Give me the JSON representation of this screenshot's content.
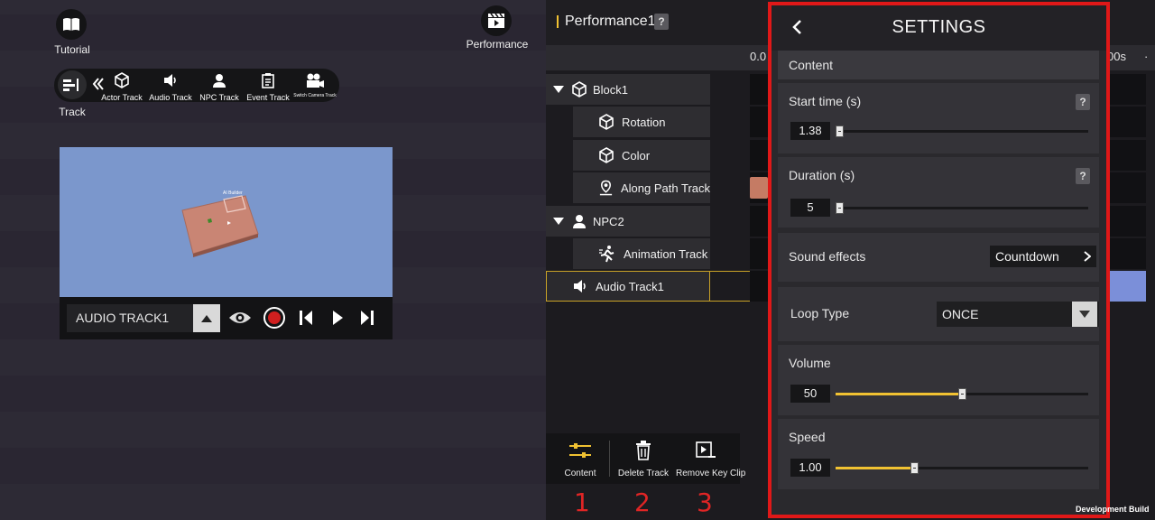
{
  "top_left": {
    "tutorial_label": "Tutorial",
    "track_label": "Track",
    "performance_label": "Performance"
  },
  "track_toolbar": {
    "items": [
      {
        "label": "Actor Track",
        "icon": "cube-icon"
      },
      {
        "label": "Audio Track",
        "icon": "speaker-icon"
      },
      {
        "label": "NPC Track",
        "icon": "person-icon"
      },
      {
        "label": "Event Track",
        "icon": "clipboard-icon"
      },
      {
        "label": "Switch Camera Track",
        "icon": "camera-icon"
      }
    ]
  },
  "preview": {
    "overlay_text": "AI Builder",
    "track_name": "AUDIO TRACK1"
  },
  "timeline": {
    "title": "Performance1",
    "help": "?",
    "ruler_start": "0.0",
    "ruler_end": "00s",
    "rows": [
      {
        "label": "Block1",
        "icon": "cube-icon",
        "level": 0,
        "expandable": true
      },
      {
        "label": "Rotation",
        "icon": "cube-icon",
        "level": 1
      },
      {
        "label": "Color",
        "icon": "cube-icon",
        "level": 1
      },
      {
        "label": "Along Path Track",
        "icon": "path-pin-icon",
        "level": 1
      },
      {
        "label": "NPC2",
        "icon": "person-icon",
        "level": 0,
        "expandable": true
      },
      {
        "label": "Animation Track",
        "icon": "running-icon",
        "level": 1
      },
      {
        "label": "Audio Track1",
        "icon": "speaker-icon",
        "level": 0,
        "selected": true
      }
    ]
  },
  "bottom_tools": {
    "content_label": "Content",
    "delete_label": "Delete Track",
    "remove_label": "Remove Key Clip"
  },
  "annotations": {
    "n1": "1",
    "n2": "2",
    "n3": "3"
  },
  "settings": {
    "title": "SETTINGS",
    "content_header": "Content",
    "start_time_label": "Start time (s)",
    "start_time_value": "1.38",
    "start_time_fraction": 0.0,
    "duration_label": "Duration (s)",
    "duration_value": "5",
    "duration_fraction": 0.0,
    "sound_effects_label": "Sound effects",
    "sound_effects_value": "Countdown",
    "loop_type_label": "Loop Type",
    "loop_type_value": "ONCE",
    "volume_label": "Volume",
    "volume_value": "50",
    "volume_fraction": 0.5,
    "speed_label": "Speed",
    "speed_value": "1.00",
    "speed_fraction": 0.31,
    "help": "?"
  },
  "footer": {
    "dev_build": "Development Build"
  },
  "colors": {
    "accent": "#f1c232",
    "panel_border": "#e01818",
    "sky": "#7b97cc",
    "selected_row_border": "#c9a227"
  }
}
